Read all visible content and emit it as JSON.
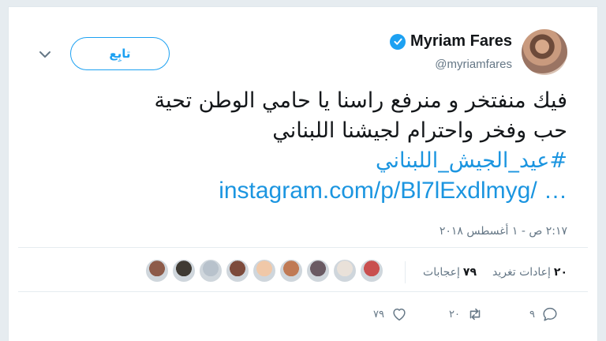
{
  "user": {
    "display_name": "Myriam Fares",
    "handle": "@myriamfares"
  },
  "header": {
    "follow_label": "تابِع"
  },
  "tweet": {
    "lines": [
      "فيك منفتخر و منرفع راسنا يا حامي الوطن تحية",
      "حب وفخر واحترام لجيشنا اللبناني"
    ],
    "hashtag": "#عيد_الجيش_اللبناني",
    "link": "instagram.com/p/Bl7lExdlmyg/ …",
    "timestamp": "٢:١٧ ص - ١ أغسطس ٢٠١٨"
  },
  "stats": {
    "retweets_count": "٢٠",
    "retweets_label": "إعادات تغريد",
    "likes_count": "٧٩",
    "likes_label": "إعجابات"
  },
  "likers": [
    {
      "color": "#c94f4f"
    },
    {
      "color": "#e9e1d9"
    },
    {
      "color": "#6a5a63"
    },
    {
      "color": "#c07a55"
    },
    {
      "color": "#f0c8a8"
    },
    {
      "color": "#7d4b3c"
    },
    {
      "color": "#b8c2cc"
    },
    {
      "color": "#3f3a33"
    },
    {
      "color": "#8d5b4a"
    }
  ],
  "actions": {
    "reply_count": "٩",
    "retweet_count": "٢٠",
    "like_count": "٧٩"
  },
  "colors": {
    "accent": "#1da1f2",
    "link": "#1b95e0",
    "secondary_text": "#657786"
  }
}
